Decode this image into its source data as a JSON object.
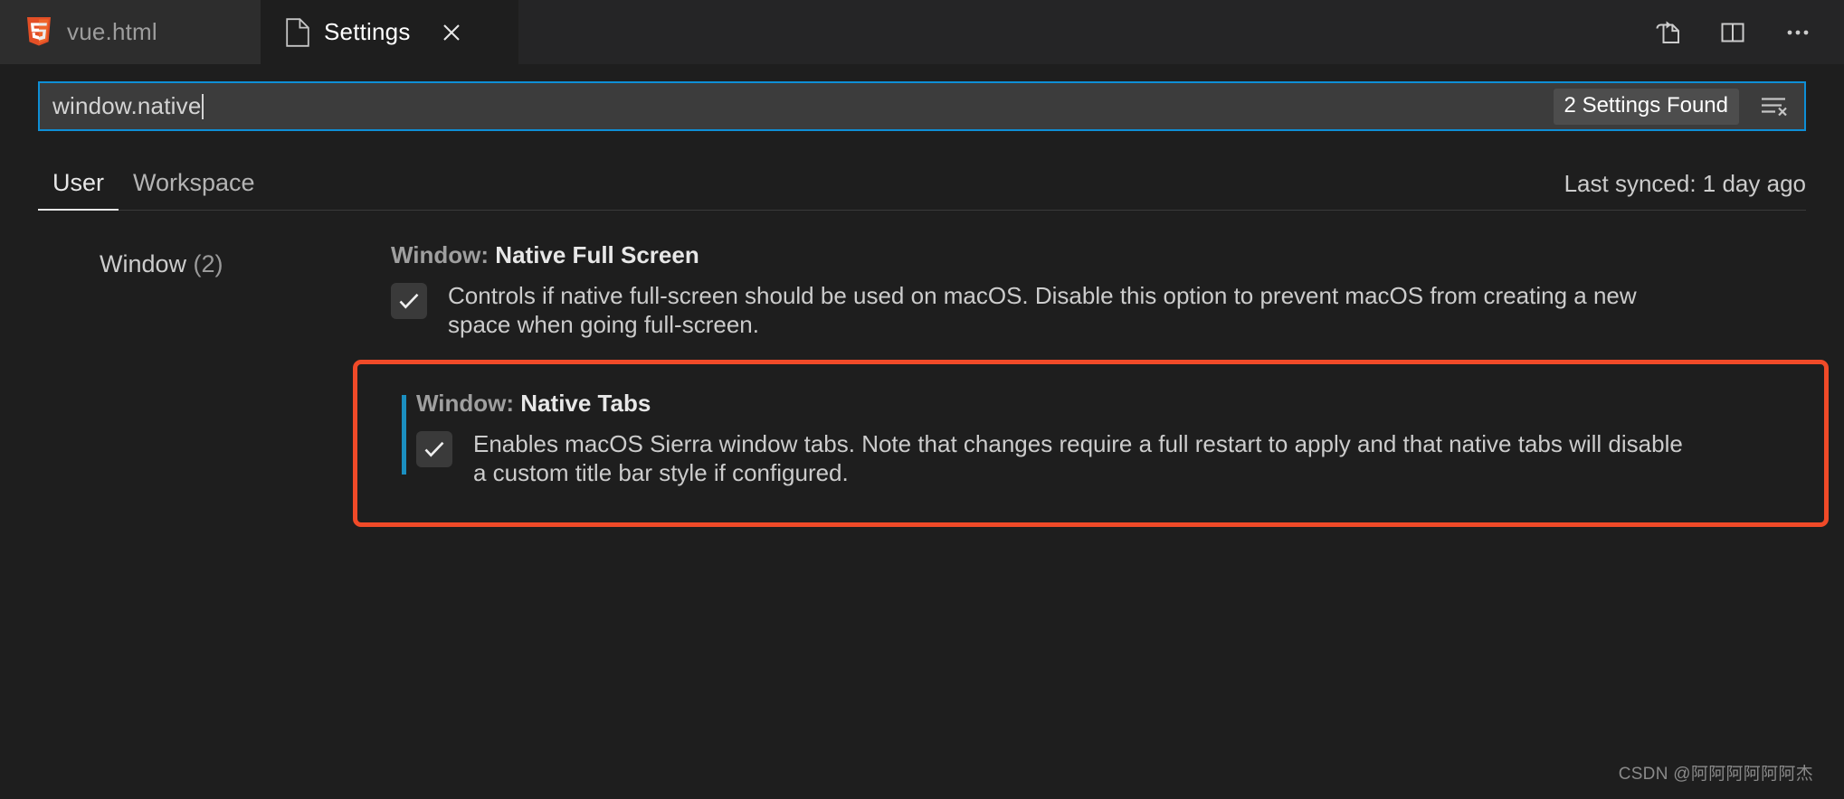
{
  "window": {
    "tabs": [
      {
        "label": "vue.html",
        "icon": "html5-icon",
        "active": false,
        "closable": false
      },
      {
        "label": "Settings",
        "icon": "file-icon",
        "active": true,
        "closable": true
      }
    ],
    "actions": [
      {
        "name": "open-settings-json-icon",
        "tooltip": "Open Settings (JSON)"
      },
      {
        "name": "split-editor-icon",
        "tooltip": "Split Editor"
      },
      {
        "name": "more-actions-icon",
        "tooltip": "More Actions..."
      }
    ]
  },
  "search": {
    "value": "window.native",
    "placeholder": "Search settings",
    "results_badge": "2 Settings Found",
    "clear_filter_icon": "clear-filter-icon"
  },
  "scope": {
    "tabs": [
      {
        "label": "User",
        "active": true
      },
      {
        "label": "Workspace",
        "active": false
      }
    ],
    "sync_status": "Last synced: 1 day ago"
  },
  "tree": {
    "items": [
      {
        "label": "Window",
        "count": "(2)"
      }
    ]
  },
  "settings": [
    {
      "category": "Window: ",
      "name": "Native Full Screen",
      "checked": true,
      "modified": false,
      "description": "Controls if native full-screen should be used on macOS. Disable this option to prevent macOS from creating a new space when going full-screen."
    },
    {
      "category": "Window: ",
      "name": "Native Tabs",
      "checked": true,
      "modified": true,
      "description": "Enables macOS Sierra window tabs. Note that changes require a full restart to apply and that native tabs will disable a custom title bar style if configured."
    }
  ],
  "annotation": {
    "color": "#F04A28",
    "target": "Window: Native Tabs"
  },
  "watermark": "CSDN @阿阿阿阿阿阿杰",
  "colors": {
    "editor_background": "#1E1E1E",
    "tabbar_background": "#252526",
    "inactive_tab": "#2D2D2D",
    "input_background": "#3C3C3C",
    "focus_border": "#0E8FD6",
    "modified_indicator": "#1B8FC0",
    "annotation_red": "#F04A28",
    "text_primary": "#CCCCCC",
    "text_bright": "#E7E7E7"
  }
}
